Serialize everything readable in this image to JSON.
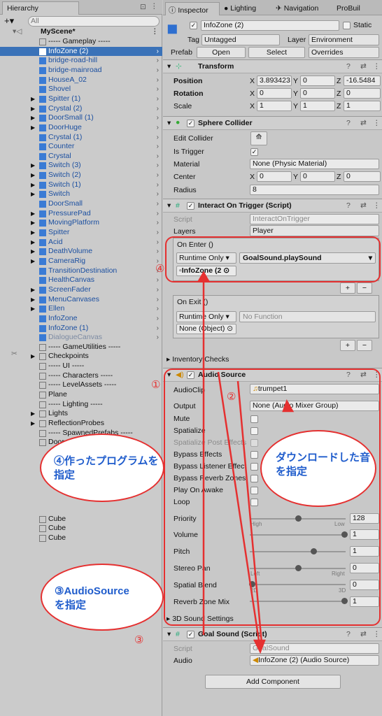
{
  "hierarchy": {
    "tab": "Hierarchy",
    "search_placeholder": "All",
    "scene": "MyScene*",
    "items": [
      "----- Gameplay -----",
      "InfoZone (2)",
      "bridge-road-hill",
      "bridge-mainroad",
      "HouseA_02",
      "Shovel",
      "Spitter (1)",
      "Crystal (2)",
      "DoorSmall (1)",
      "DoorHuge",
      "Crystal (1)",
      "Counter",
      "Crystal",
      "Switch (3)",
      "Switch (2)",
      "Switch (1)",
      "Switch",
      "DoorSmall",
      "PressurePad",
      "MovingPlatform",
      "Spitter",
      "Acid",
      "DeathVolume",
      "CameraRig",
      "TransitionDestination",
      "HealthCanvas",
      "ScreenFader",
      "MenuCanvases",
      "Ellen",
      "InfoZone",
      "InfoZone (1)",
      "DialogueCanvas",
      "----- GameUtilities -----",
      "Checkpoints",
      "----- UI -----",
      "----- Characters -----",
      "----- LevelAssets -----",
      "Plane",
      "----- Lighting -----",
      "Lights",
      "ReflectionProbes",
      "----- SpawnedPrefabs -----",
      "Door",
      "",
      "",
      "",
      "",
      "",
      "",
      "",
      "Cube",
      "Cube",
      "Cube"
    ]
  },
  "inspector": {
    "tabs": [
      "Inspector",
      "Lighting",
      "Navigation",
      "ProBuil"
    ],
    "object_name": "InfoZone (2)",
    "static_label": "Static",
    "tag_label": "Tag",
    "tag_value": "Untagged",
    "layer_label": "Layer",
    "layer_value": "Environment",
    "prefab_label": "Prefab",
    "open": "Open",
    "select": "Select",
    "overrides": "Overrides",
    "transform": {
      "title": "Transform",
      "position": "Position",
      "rotation": "Rotation",
      "scale": "Scale",
      "pos": [
        "3.893423",
        "0",
        "-16.5484"
      ],
      "rot": [
        "0",
        "0",
        "0"
      ],
      "scl": [
        "1",
        "1",
        "1"
      ]
    },
    "sphere": {
      "title": "Sphere Collider",
      "edit_collider": "Edit Collider",
      "is_trigger": "Is Trigger",
      "material": "Material",
      "material_value": "None (Physic Material)",
      "center": "Center",
      "center_vals": [
        "0",
        "0",
        "0"
      ],
      "radius": "Radius",
      "radius_value": "8"
    },
    "interact": {
      "title": "Interact On Trigger (Script)",
      "script": "Script",
      "script_value": "InteractOnTrigger",
      "layers": "Layers",
      "layers_value": "Player",
      "on_enter": "On Enter ()",
      "runtime": "Runtime Only",
      "function": "GoalSound.playSound",
      "object": "InfoZone (2",
      "on_exit": "On Exit ()",
      "runtime2": "Runtime Only",
      "function2": "No Function",
      "object2": "None (Object)",
      "inventory": "Inventory Checks"
    },
    "audio": {
      "title": "Audio Source",
      "audioclip": "AudioClip",
      "clip_value": "trumpet1",
      "output": "Output",
      "output_value": "None (Audio Mixer Group)",
      "mute": "Mute",
      "spatialize": "Spatialize",
      "spatialize_post": "Spatialize Post Effects",
      "bypass_effects": "Bypass Effects",
      "bypass_listener": "Bypass Listener Effect",
      "bypass_reverb": "Bypass Reverb Zones",
      "play_on_awake": "Play On Awake",
      "loop": "Loop",
      "priority": "Priority",
      "priority_value": "128",
      "high": "High",
      "low": "Low",
      "volume": "Volume",
      "volume_value": "1",
      "pitch": "Pitch",
      "pitch_value": "1",
      "stereo_pan": "Stereo Pan",
      "stereo_value": "0",
      "left": "Left",
      "right": "Right",
      "spatial_blend": "Spatial Blend",
      "blend_value": "0",
      "d2": "2D",
      "d3": "3D",
      "reverb_mix": "Reverb Zone Mix",
      "reverb_value": "1",
      "sound3d": "3D Sound Settings"
    },
    "goal": {
      "title": "Goal Sound (Script)",
      "script": "Script",
      "script_value": "GoalSound",
      "audio": "Audio",
      "audio_value": "InfoZone (2) (Audio Source)"
    },
    "add_component": "Add Component"
  },
  "annotations": {
    "n1": "①",
    "n2": "②",
    "n3": "③",
    "n3b": "③",
    "n4": "④",
    "c4": "④作ったプログラムを指定",
    "c2": "ダウンロードした音を指定",
    "c3a": "③AudioSource",
    "c3b": "を指定"
  },
  "colors": {
    "accent": "#e53030",
    "callout_text": "#1f5ccc",
    "selection": "#3a72b8"
  }
}
